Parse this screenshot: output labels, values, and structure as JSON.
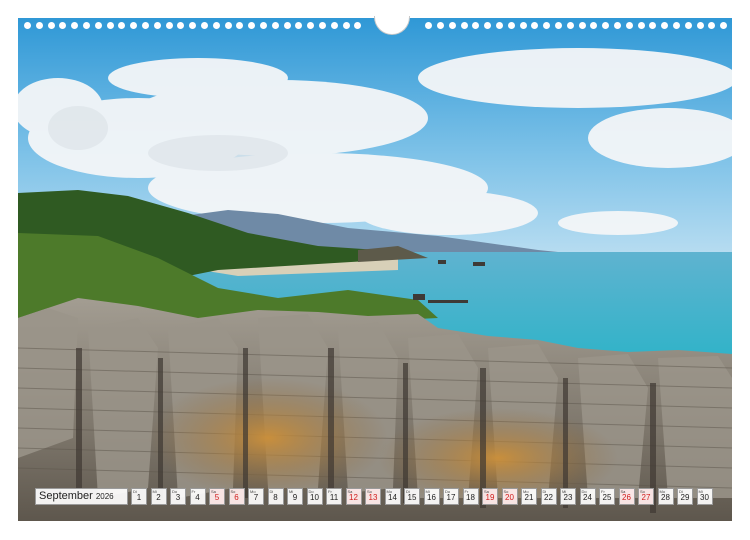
{
  "calendar": {
    "month": "September",
    "year": "2026",
    "days": [
      {
        "n": "1",
        "wd": "Di",
        "weekend": false
      },
      {
        "n": "2",
        "wd": "Mi",
        "weekend": false
      },
      {
        "n": "3",
        "wd": "Do",
        "weekend": false
      },
      {
        "n": "4",
        "wd": "Fr",
        "weekend": false
      },
      {
        "n": "5",
        "wd": "Sa",
        "weekend": true
      },
      {
        "n": "6",
        "wd": "So",
        "weekend": true
      },
      {
        "n": "7",
        "wd": "Mo",
        "weekend": false
      },
      {
        "n": "8",
        "wd": "Di",
        "weekend": false
      },
      {
        "n": "9",
        "wd": "Mi",
        "weekend": false
      },
      {
        "n": "10",
        "wd": "Do",
        "weekend": false
      },
      {
        "n": "11",
        "wd": "Fr",
        "weekend": false
      },
      {
        "n": "12",
        "wd": "Sa",
        "weekend": true
      },
      {
        "n": "13",
        "wd": "So",
        "weekend": true
      },
      {
        "n": "14",
        "wd": "Mo",
        "weekend": false
      },
      {
        "n": "15",
        "wd": "Di",
        "weekend": false
      },
      {
        "n": "16",
        "wd": "Mi",
        "weekend": false
      },
      {
        "n": "17",
        "wd": "Do",
        "weekend": false
      },
      {
        "n": "18",
        "wd": "Fr",
        "weekend": false
      },
      {
        "n": "19",
        "wd": "Sa",
        "weekend": true
      },
      {
        "n": "20",
        "wd": "So",
        "weekend": true
      },
      {
        "n": "21",
        "wd": "Mo",
        "weekend": false
      },
      {
        "n": "22",
        "wd": "Di",
        "weekend": false
      },
      {
        "n": "23",
        "wd": "Mi",
        "weekend": false
      },
      {
        "n": "24",
        "wd": "Do",
        "weekend": false
      },
      {
        "n": "25",
        "wd": "Fr",
        "weekend": false
      },
      {
        "n": "26",
        "wd": "Sa",
        "weekend": true
      },
      {
        "n": "27",
        "wd": "So",
        "weekend": true
      },
      {
        "n": "28",
        "wd": "Mo",
        "weekend": false
      },
      {
        "n": "29",
        "wd": "Di",
        "weekend": false
      },
      {
        "n": "30",
        "wd": "Mi",
        "weekend": false
      }
    ]
  },
  "colors": {
    "sky": "#4aa6dc",
    "sea": "#3fb3cf",
    "rock": "#8a8378",
    "weekend_text": "#d11c1c"
  }
}
